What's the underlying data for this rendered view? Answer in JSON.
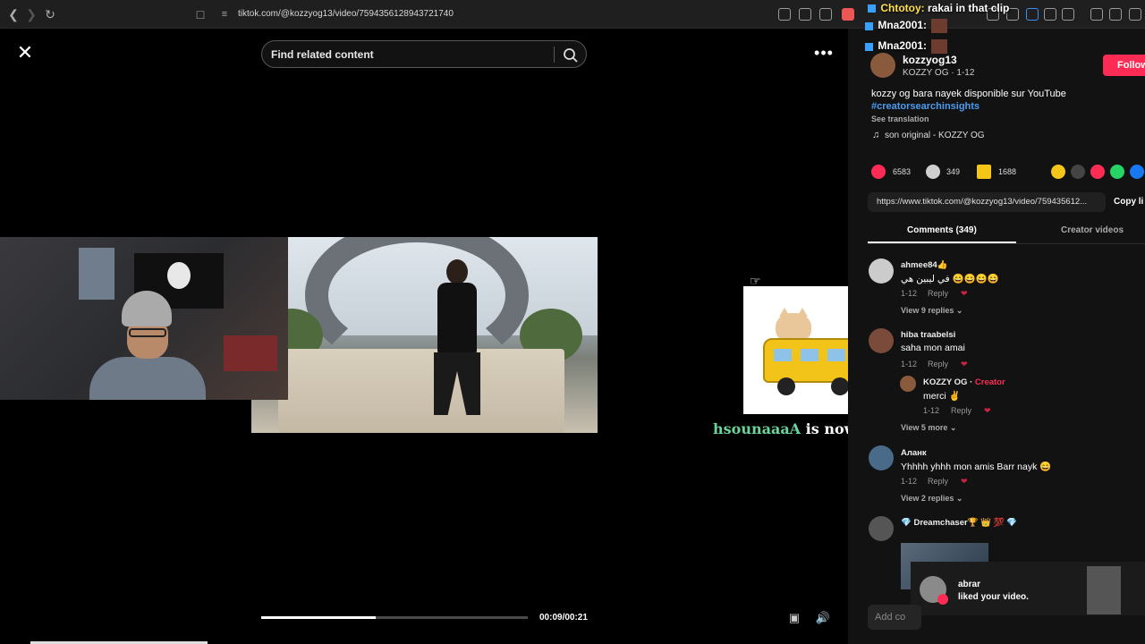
{
  "browser": {
    "url": "tiktok.com/@kozzyog13/video/7594356128943721740"
  },
  "search": {
    "placeholder": "Find related content"
  },
  "player": {
    "time": "00:09/00:21",
    "progress": 0.43
  },
  "alert": {
    "name": "hsounaaaA",
    "message": "is now following!"
  },
  "chat": [
    {
      "user": "Chtotoy:",
      "text": "rakai in that clip"
    },
    {
      "user": "Mna2001:",
      "text": ""
    },
    {
      "user": "Mna2001:",
      "text": ""
    }
  ],
  "author": {
    "username": "kozzyog13",
    "subtitle": "KOZZY OG · 1-12",
    "follow_label": "Follow"
  },
  "description": {
    "text": "kozzy og bara nayek disponible sur YouTube",
    "hashtag": "#creatorsearchinsights",
    "translation": "See translation",
    "music": "son original - KOZZY OG"
  },
  "stats": {
    "likes": "6583",
    "comments": "349",
    "saves": "1688"
  },
  "share": {
    "link": "https://www.tiktok.com/@kozzyog13/video/759435612...",
    "copy_label": "Copy li"
  },
  "tabs": {
    "comments": "Comments (349)",
    "creator": "Creator videos"
  },
  "comments": [
    {
      "name": "ahmee84👍",
      "text": "في ليبين هي 😄😄😄😄",
      "date": "1-12",
      "reply": "Reply",
      "more": "View 9 replies ⌄"
    },
    {
      "name": "hiba traabelsi",
      "text": "saha mon amai",
      "date": "1-12",
      "reply": "Reply"
    },
    {
      "name": "KOZZY OG ·",
      "creator": "Creator",
      "text": "merci ✌",
      "date": "1-12",
      "reply": "Reply",
      "more": "View 5 more ⌄"
    },
    {
      "name": "Аланк",
      "text": "Yhhhh yhhh mon amis Barr nayk 😄",
      "date": "1-12",
      "reply": "Reply",
      "more": "View 2 replies ⌄"
    },
    {
      "name": "💎 Dreamchaser🏆 👑 💯 💎"
    }
  ],
  "notification": {
    "name": "abrar",
    "message": "liked your video."
  },
  "add_comment": {
    "placeholder": "Add co"
  },
  "colors": {
    "accent": "#fe2c55",
    "hashtag": "#4b9cf0",
    "alert_name": "#6bd49a"
  }
}
